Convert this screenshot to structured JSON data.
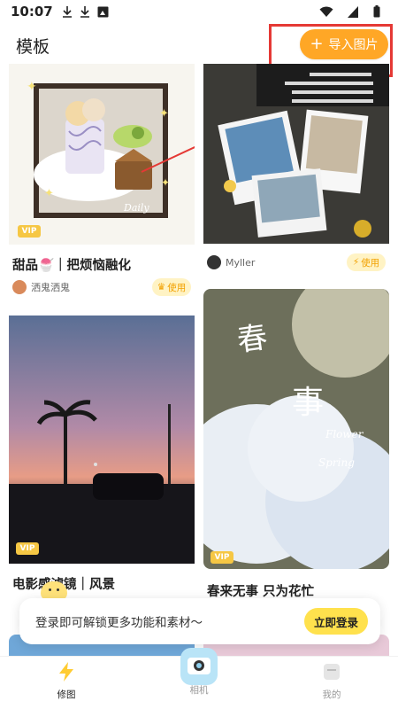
{
  "status_bar": {
    "time": "10:07"
  },
  "header": {
    "title": "模板",
    "import_button": {
      "icon": "plus",
      "label": "导入图片"
    }
  },
  "templates": [
    {
      "title": "甜品🍧｜把烦恼融化",
      "vip": "VIP",
      "author": "",
      "use_label": "",
      "sticker_text": "Daily"
    },
    {
      "title": "",
      "vip": "",
      "author": "Myller",
      "use_label": "使用"
    },
    {
      "title": "",
      "vip": "",
      "author": "洒鬼洒鬼",
      "use_label": "使用"
    },
    {
      "title": "电影感滤镜｜风景",
      "vip": "VIP",
      "author": "",
      "use_label": ""
    },
    {
      "title": "春来无事 只为花忙",
      "vip": "VIP",
      "author": "",
      "use_label": "",
      "art_text": [
        "Flower",
        "Spring"
      ]
    }
  ],
  "login_banner": {
    "text": "登录即可解锁更多功能和素材～",
    "button": "立即登录"
  },
  "bottom_nav": [
    {
      "label": "修图",
      "icon": "bolt-icon",
      "active": true
    },
    {
      "label": "相机",
      "icon": "camera-icon",
      "active": false
    },
    {
      "label": "我的",
      "icon": "profile-icon",
      "active": false
    }
  ],
  "colors": {
    "accent": "#ffa726",
    "vip": "#f6c744",
    "use_bg": "#fff3c4",
    "login_button": "#ffe14d"
  }
}
